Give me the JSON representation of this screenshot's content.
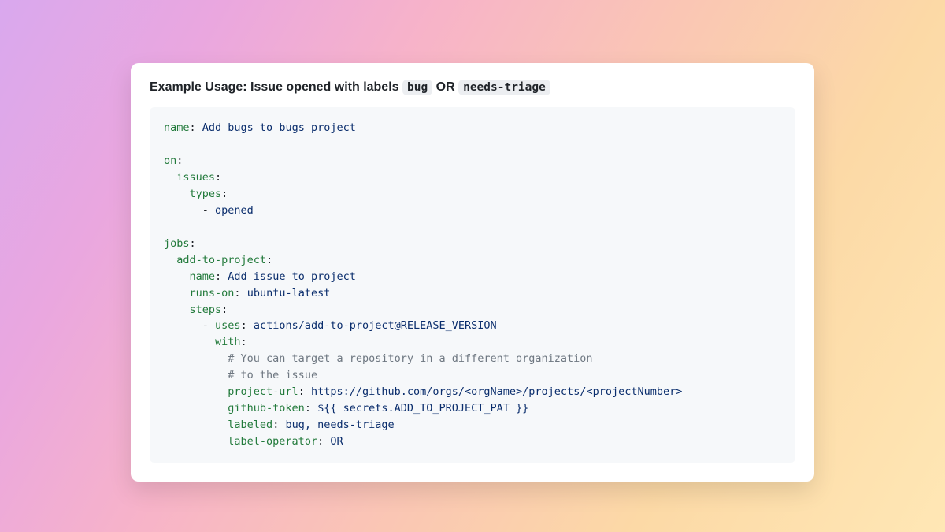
{
  "heading": {
    "prefix": "Example Usage: Issue opened with labels ",
    "code1": "bug",
    "mid": " OR ",
    "code2": "needs-triage"
  },
  "yaml": {
    "workflow_name_key": "name",
    "workflow_name_val": "Add bugs to bugs project",
    "on_key": "on",
    "issues_key": "issues",
    "types_key": "types",
    "types_item": "opened",
    "jobs_key": "jobs",
    "job_id": "add-to-project",
    "job_name_key": "name",
    "job_name_val": "Add issue to project",
    "runs_on_key": "runs-on",
    "runs_on_val": "ubuntu-latest",
    "steps_key": "steps",
    "uses_key": "uses",
    "uses_val": "actions/add-to-project@RELEASE_VERSION",
    "with_key": "with",
    "comment1": "# You can target a repository in a different organization",
    "comment2": "# to the issue",
    "project_url_key": "project-url",
    "project_url_val": "https://github.com/orgs/<orgName>/projects/<projectNumber>",
    "github_token_key": "github-token",
    "github_token_val": "${{ secrets.ADD_TO_PROJECT_PAT }}",
    "labeled_key": "labeled",
    "labeled_val": "bug, needs-triage",
    "label_operator_key": "label-operator",
    "label_operator_val": "OR"
  }
}
